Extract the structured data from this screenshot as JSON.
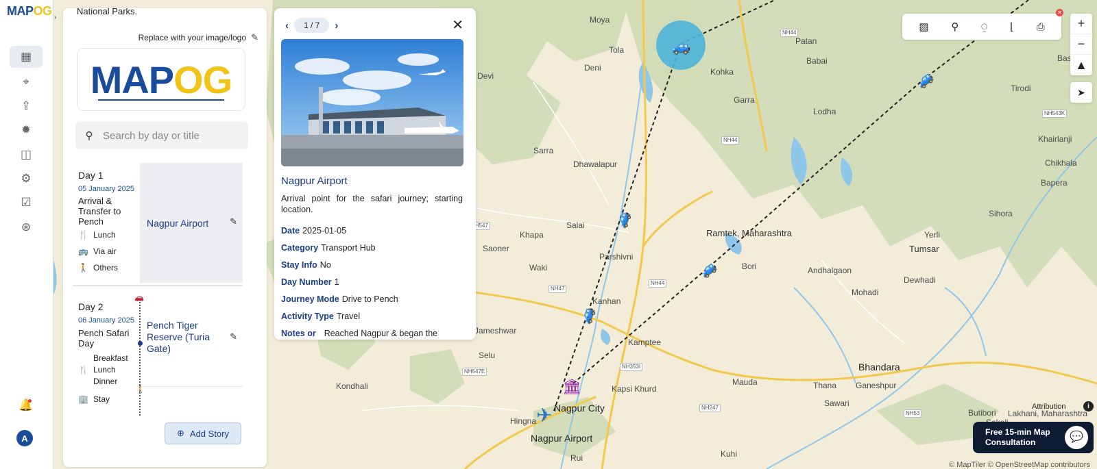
{
  "app": {
    "logo_main": "MAP",
    "logo_accent": "OG"
  },
  "rail": {
    "icons": [
      "map-icon",
      "location-pin-icon",
      "upload-icon",
      "sun-gear-icon",
      "map-layers-icon",
      "settings-icon",
      "checklist-icon",
      "map-pin-icon"
    ],
    "avatar_letter": "A"
  },
  "story": {
    "intro_text": "National Parks.",
    "replace_logo_label": "Replace with your image/logo",
    "logo_main": "MAP",
    "logo_accent": "OG",
    "search_placeholder": "Search by day or title",
    "add_story_label": "Add Story",
    "days": [
      {
        "title": "Day 1",
        "date": "05 January 2025",
        "name": "Arrival & Transfer to Pench",
        "meals": "Lunch",
        "mode": "Via air",
        "extra": "Others",
        "card_title": "Nagpur Airport"
      },
      {
        "title": "Day 2",
        "date": "06 January 2025",
        "name": "Pench Safari Day",
        "meals_1": "Breakfast",
        "meals_2": "Lunch",
        "meals_3": "Dinner",
        "stay": "Stay",
        "card_title": "Pench Tiger Reserve (Turia Gate)"
      }
    ]
  },
  "popup": {
    "pager": "1 / 7",
    "title": "Nagpur Airport",
    "description": "Arrival point for the safari journey; starting location.",
    "props": [
      {
        "label": "Date",
        "value": "2025-01-05"
      },
      {
        "label": "Category",
        "value": "Transport Hub"
      },
      {
        "label": "Stay Info",
        "value": "No"
      },
      {
        "label": "Day Number",
        "value": "1"
      },
      {
        "label": "Journey Mode",
        "value": "Drive to Pench"
      },
      {
        "label": "Activity Type",
        "value": "Travel"
      },
      {
        "label": "Notes or",
        "value": "Reached Nagpur & began the"
      }
    ]
  },
  "map": {
    "places": [
      "Moya",
      "Tola",
      "Deni",
      "Patan",
      "Babai",
      "Kohka",
      "Basi",
      "Tirodi",
      "Garra",
      "Lodha",
      "Devi",
      "Sarra",
      "Dhawalapur",
      "Chikhala",
      "Khairlanji",
      "Bapera",
      "Salai",
      "Ramtek, Maharashtra",
      "Parshivni",
      "Sihora",
      "Yerli",
      "Tumsar",
      "Saoner",
      "Khapa",
      "Waki",
      "Bori",
      "Andhalgaon",
      "Dewhadi",
      "Mohadi",
      "Kanhan",
      "Kamptee",
      "Selu",
      "Bhandara",
      "Kondhali",
      "Mauda",
      "Kapsi Khurd",
      "Thana",
      "Ganeshpur",
      "Nagpur City",
      "Sawari",
      "Hingna",
      "Butibori",
      "Lakhani, Maharashtra",
      "Sakoli",
      "Nagpur Airport",
      "Kuhi",
      "Rui",
      "Jameshwar"
    ],
    "highways": [
      "NH44",
      "NH44",
      "NH547",
      "NH47",
      "NH44",
      "NH353I",
      "NH547E",
      "NH247",
      "NH53",
      "NH543K"
    ]
  },
  "controls": {
    "attribution": "Attribution",
    "copyright": "© MapTiler © OpenStreetMap contributors",
    "consult": "Free 15-min Map Consultation"
  }
}
